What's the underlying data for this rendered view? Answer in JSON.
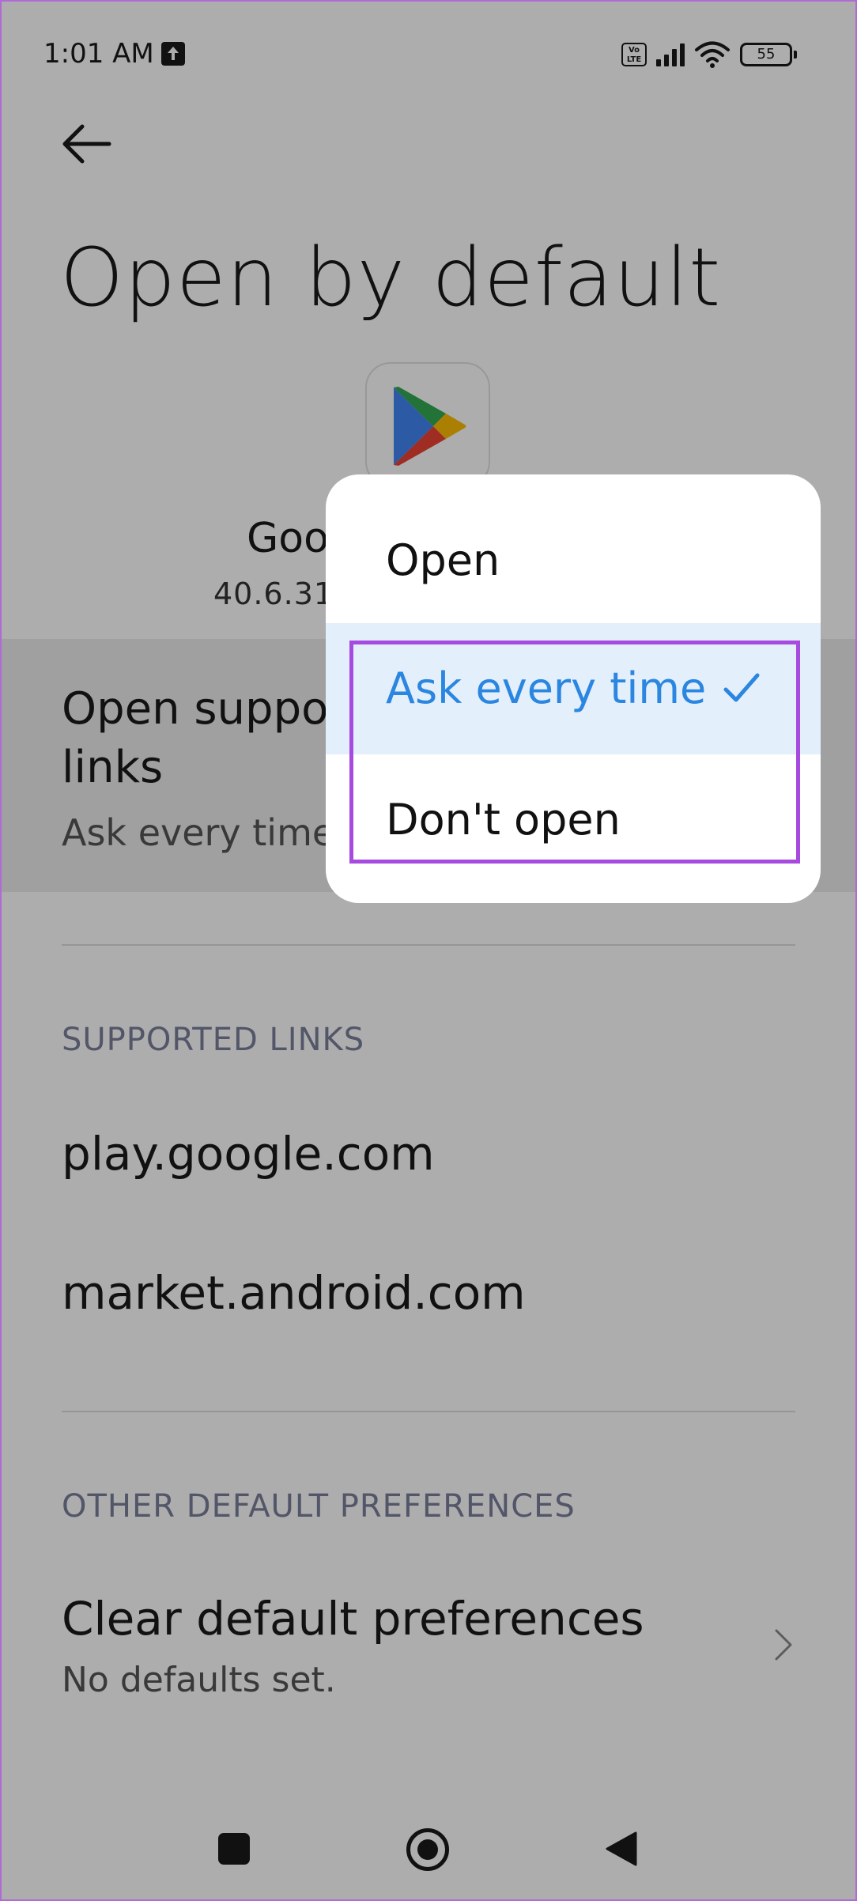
{
  "status_bar": {
    "time": "1:01 AM",
    "volte": "Vo LTE",
    "battery": "55"
  },
  "page": {
    "title": "Open by default"
  },
  "app": {
    "name": "Goo",
    "version": "40.6.31"
  },
  "open_links": {
    "title": "Open suppo links",
    "subtitle": "Ask every time"
  },
  "supported_links": {
    "header": "SUPPORTED LINKS",
    "items": [
      "play.google.com",
      "market.android.com"
    ]
  },
  "other_prefs": {
    "header": "OTHER DEFAULT PREFERENCES",
    "clear_title": "Clear default preferences",
    "clear_subtitle": "No defaults set."
  },
  "popup": {
    "options": [
      "Open",
      "Ask every time",
      "Don't open"
    ],
    "selected": "Ask every time"
  },
  "icons": {
    "back": "back-arrow-icon",
    "check": "check-icon",
    "chevron": "chevron-right-icon",
    "nav_recents": "recents-icon",
    "nav_home": "home-icon",
    "nav_back": "nav-back-icon"
  },
  "colors": {
    "accent": "#2a86e0",
    "selected_bg": "#e4effc",
    "highlight_border": "#a64ae0",
    "section_header": "#7a7f9a"
  }
}
